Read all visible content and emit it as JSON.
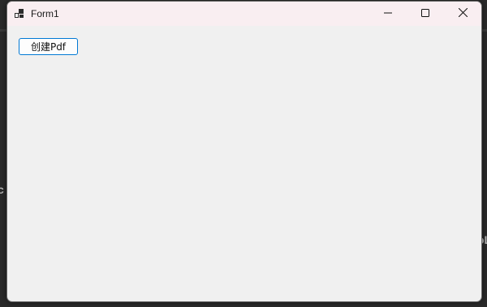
{
  "window": {
    "title": "Form1",
    "controls": {
      "minimize": "minimize-icon",
      "maximize": "maximize-icon",
      "close": "close-icon"
    }
  },
  "form": {
    "create_pdf_label": "创建Pdf"
  },
  "background": {
    "left_edge_text": "c",
    "right_edge_text": "oL"
  },
  "colors": {
    "titlebar": "#f9eef1",
    "client": "#f0f0f0",
    "button_border": "#0078d4",
    "desktop": "#2a2a2a"
  }
}
